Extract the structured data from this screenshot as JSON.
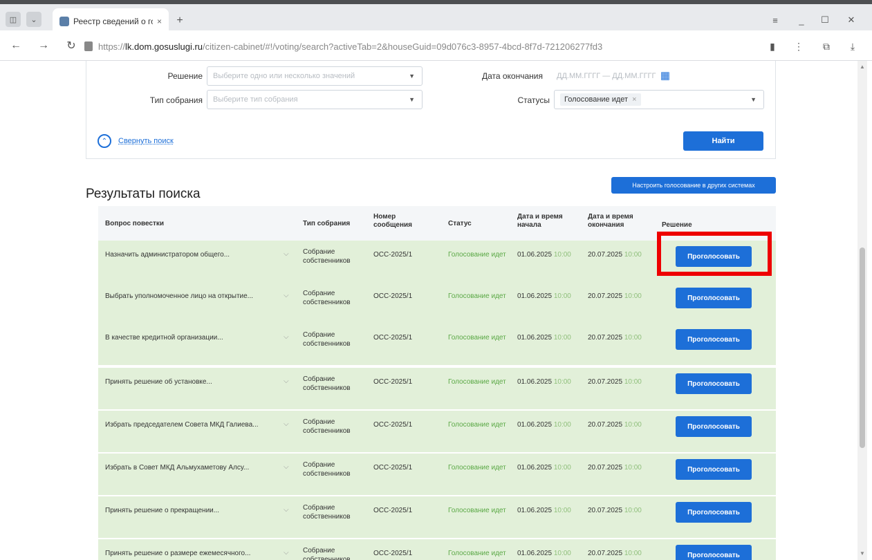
{
  "browser": {
    "tab_title": "Реестр сведений о го:",
    "tab_close": "×",
    "new_tab": "+",
    "url_prefix": "https://",
    "url_host": "lk.dom.gosuslugi.ru",
    "url_path": "/citizen-cabinet/#!/voting/search?activeTab=2&houseGuid=09d076c3-8957-4bcd-8f7d-721206277fd3"
  },
  "search": {
    "decision_label": "Решение",
    "decision_placeholder": "Выберите одно или несколько значений",
    "end_date_label": "Дата окончания",
    "end_date_placeholder": "ДД.ММ.ГГГГ — ДД.ММ.ГГГГ",
    "meeting_type_label": "Тип собрания",
    "meeting_type_placeholder": "Выберите тип собрания",
    "statuses_label": "Статусы",
    "status_chip": "Голосование идет",
    "collapse_label": "Свернуть поиск",
    "find_button": "Найти"
  },
  "results": {
    "title": "Результаты поиска",
    "configure_button": "Настроить голосование в других системах",
    "columns": {
      "question": "Вопрос повестки",
      "type": "Тип собрания",
      "number": "Номер сообщения",
      "status": "Статус",
      "start": "Дата и время начала",
      "end": "Дата и время окончания",
      "decision": "Решение"
    },
    "rows": [
      {
        "question": "Назначить администратором общего...",
        "type": "Собрание собственников",
        "number": "ОСС-2025/1",
        "status": "Голосование идет",
        "start_date": "01.06.2025",
        "start_time": "10:00",
        "end_date": "20.07.2025",
        "end_time": "10:00",
        "action": "Проголосовать"
      },
      {
        "question": "Выбрать уполномоченное лицо на открытие...",
        "type": "Собрание собственников",
        "number": "ОСС-2025/1",
        "status": "Голосование идет",
        "start_date": "01.06.2025",
        "start_time": "10:00",
        "end_date": "20.07.2025",
        "end_time": "10:00",
        "action": "Проголосовать"
      },
      {
        "question": "В качестве кредитной организации...",
        "type": "Собрание собственников",
        "number": "ОСС-2025/1",
        "status": "Голосование идет",
        "start_date": "01.06.2025",
        "start_time": "10:00",
        "end_date": "20.07.2025",
        "end_time": "10:00",
        "action": "Проголосовать"
      },
      {
        "question": "Принять решение об установке...",
        "type": "Собрание собственников",
        "number": "ОСС-2025/1",
        "status": "Голосование идет",
        "start_date": "01.06.2025",
        "start_time": "10:00",
        "end_date": "20.07.2025",
        "end_time": "10:00",
        "action": "Проголосовать"
      },
      {
        "question": "Избрать председателем Совета МКД Галиева...",
        "type": "Собрание собственников",
        "number": "ОСС-2025/1",
        "status": "Голосование идет",
        "start_date": "01.06.2025",
        "start_time": "10:00",
        "end_date": "20.07.2025",
        "end_time": "10:00",
        "action": "Проголосовать"
      },
      {
        "question": "Избрать в Совет МКД Альмухаметову Алсу...",
        "type": "Собрание собственников",
        "number": "ОСС-2025/1",
        "status": "Голосование идет",
        "start_date": "01.06.2025",
        "start_time": "10:00",
        "end_date": "20.07.2025",
        "end_time": "10:00",
        "action": "Проголосовать"
      },
      {
        "question": "Принять решение о прекращении...",
        "type": "Собрание собственников",
        "number": "ОСС-2025/1",
        "status": "Голосование идет",
        "start_date": "01.06.2025",
        "start_time": "10:00",
        "end_date": "20.07.2025",
        "end_time": "10:00",
        "action": "Проголосовать"
      },
      {
        "question": "Принять решение о размере ежемесячного...",
        "type": "Собрание собственников",
        "number": "ОСС-2025/1",
        "status": "Голосование идет",
        "start_date": "01.06.2025",
        "start_time": "10:00",
        "end_date": "20.07.2025",
        "end_time": "10:00",
        "action": "Проголосовать"
      }
    ]
  },
  "colors": {
    "accent": "#1d6fd8",
    "row_bg": "#e2f0d9",
    "status_green": "#5aa845",
    "highlight": "#ee0000"
  }
}
